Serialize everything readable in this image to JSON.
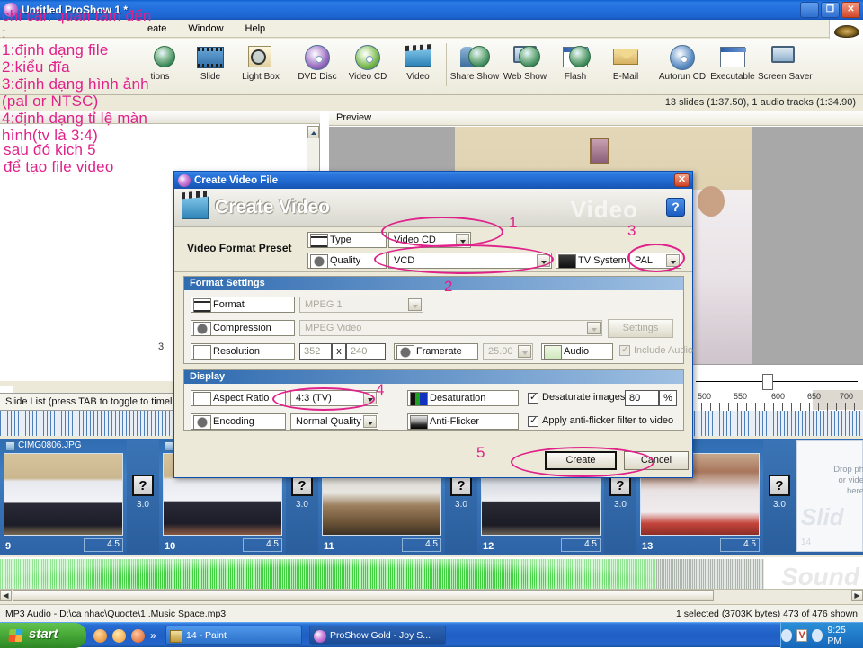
{
  "window": {
    "title": "Untitled ProShow 1 *",
    "minimize_label": "_",
    "restore_label": "❐",
    "close_label": "✕",
    "app_icon": "proshow-icon"
  },
  "menubar": {
    "items": [
      {
        "label": "eate"
      },
      {
        "label": "Window"
      },
      {
        "label": "Help"
      }
    ]
  },
  "toolbar": {
    "items": [
      {
        "label": "tions",
        "icon": "options-icon"
      },
      {
        "label": "Slide",
        "icon": "slide-icon"
      },
      {
        "label": "Light Box",
        "icon": "lightbox-icon"
      },
      {
        "label": "DVD Disc",
        "icon": "dvd-disc-icon"
      },
      {
        "label": "Video CD",
        "icon": "video-cd-icon"
      },
      {
        "label": "Video",
        "icon": "video-icon"
      },
      {
        "label": "Share Show",
        "icon": "share-show-icon"
      },
      {
        "label": "Web Show",
        "icon": "web-show-icon"
      },
      {
        "label": "Flash",
        "icon": "flash-icon"
      },
      {
        "label": "E-Mail",
        "icon": "email-icon"
      },
      {
        "label": "Autorun CD",
        "icon": "autorun-cd-icon"
      },
      {
        "label": "Executable",
        "icon": "executable-icon"
      },
      {
        "label": "Screen Saver",
        "icon": "screen-saver-icon"
      }
    ]
  },
  "show_info": "13 slides (1:37.50), 1 audio tracks (1:34.90)",
  "left_panel": {
    "list_number": "3"
  },
  "preview": {
    "header": "Preview"
  },
  "ruler": {
    "ticks": [
      "500",
      "550",
      "600",
      "650",
      "700"
    ]
  },
  "slide_list": {
    "header": "Slide List (press TAB to toggle to timeline)",
    "slides": [
      {
        "num": "9",
        "name": "CIMG0806.JPG",
        "duration": "4.5"
      },
      {
        "num": "10",
        "name": "",
        "duration": "4.5"
      },
      {
        "num": "11",
        "name": "",
        "duration": "4.5"
      },
      {
        "num": "12",
        "name": "",
        "duration": "4.5"
      },
      {
        "num": "13",
        "name": "",
        "duration": "4.5"
      }
    ],
    "transitions": [
      {
        "symbol": "?",
        "duration": "3.0"
      },
      {
        "symbol": "?",
        "duration": "3.0"
      },
      {
        "symbol": "?",
        "duration": "3.0"
      },
      {
        "symbol": "?",
        "duration": "3.0"
      },
      {
        "symbol": "?",
        "duration": "3.0"
      }
    ],
    "drop_zone": {
      "line1": "Drop ph",
      "line2": "or vide",
      "line3": "here",
      "big": "Slid",
      "num": "14"
    }
  },
  "soundtrack": {
    "watermark": "Sound"
  },
  "statusbar": {
    "left": "MP3 Audio - D:\\ca nhac\\Quocte\\1 .Music Space.mp3",
    "right": "1 selected (3703K bytes) 473 of 476 shown"
  },
  "taskbar": {
    "start_label": "start",
    "quicklaunch_chevron": "»",
    "tasks": [
      {
        "label": "14 - Paint",
        "active": false,
        "icon": "paint-icon"
      },
      {
        "label": "ProShow Gold - Joy S...",
        "active": true,
        "icon": "proshow-icon"
      }
    ],
    "tray_v": "V",
    "clock": "9:25 PM"
  },
  "dialog": {
    "title": "Create Video File",
    "close_label": "✕",
    "heading": "Create Video",
    "watermark": "Video",
    "help_label": "?",
    "preset": {
      "section_label": "Video Format Preset",
      "type_label": "Type",
      "type_value": "Video CD",
      "quality_label": "Quality",
      "quality_value": "VCD",
      "tv_system_label": "TV System",
      "tv_system_value": "PAL"
    },
    "format_settings": {
      "title": "Format Settings",
      "format_label": "Format",
      "format_value": "MPEG 1",
      "compression_label": "Compression",
      "compression_value": "MPEG Video",
      "settings_button": "Settings",
      "resolution_label": "Resolution",
      "resolution_width": "352",
      "resolution_x": "x",
      "resolution_height": "240",
      "framerate_label": "Framerate",
      "framerate_value": "25.00",
      "audio_label": "Audio",
      "include_audio_label": "Include Audio"
    },
    "display": {
      "title": "Display",
      "aspect_ratio_label": "Aspect Ratio",
      "aspect_ratio_value": "4:3 (TV)",
      "encoding_label": "Encoding",
      "encoding_value": "Normal Quality",
      "desaturation_label": "Desaturation",
      "anti_flicker_label": "Anti-Flicker",
      "desaturate_images_label": "Desaturate images to",
      "desaturate_value": "80",
      "percent_label": "%",
      "anti_flicker_filter_label": "Apply anti-flicker filter to video"
    },
    "create_button": "Create",
    "cancel_button": "Cancel"
  },
  "annotations": {
    "note": "chỉ cần quan tâm đến\n:\n1:định dạng file\n2:kiểu đĩa\n3:định dạng hình ảnh\n(pal or NTSC)\n4:định dạng tỉ lệ màn\nhình(tv là 3:4)",
    "note2": "sau đó kich 5\nđể tạo file video",
    "markers": [
      "1",
      "2",
      "3",
      "4",
      "5"
    ],
    "color": "#e0218a"
  }
}
